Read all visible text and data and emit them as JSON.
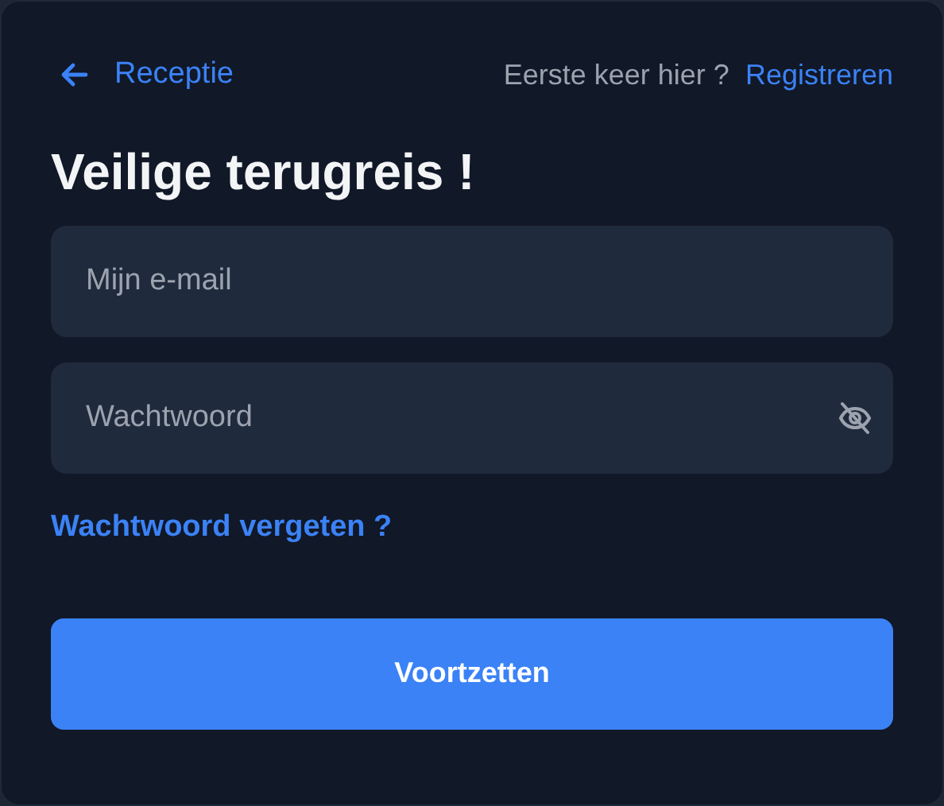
{
  "header": {
    "back_link": "Receptie",
    "prompt": "Eerste keer hier ?",
    "register_link": "Registreren"
  },
  "title": "Veilige terugreis !",
  "fields": [
    {
      "placeholder": "Mijn e-mail",
      "kind": "email"
    },
    {
      "placeholder": "Wachtwoord",
      "kind": "password"
    }
  ],
  "forgot_link": "Wachtwoord vergeten ?",
  "submit_button": "Voortzetten"
}
